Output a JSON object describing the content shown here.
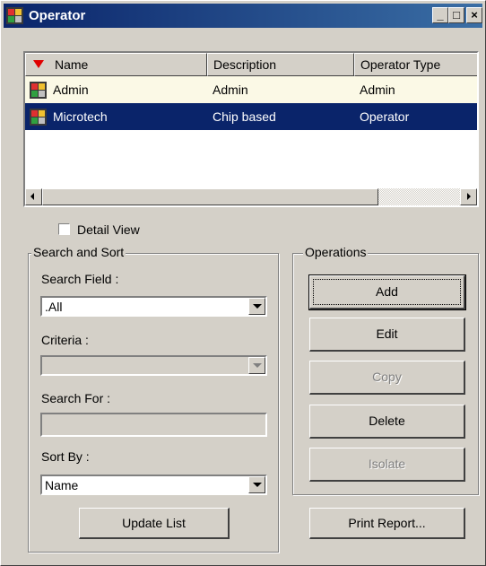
{
  "window": {
    "title": "Operator",
    "controls": {
      "minimize": "_",
      "maximize": "□",
      "close": "×"
    }
  },
  "list": {
    "columns": [
      {
        "label": "Name",
        "sorted": "descending"
      },
      {
        "label": "Description"
      },
      {
        "label": "Operator Type"
      }
    ],
    "rows": [
      {
        "name": "Admin",
        "description": "Admin",
        "type": "Admin",
        "selected": false
      },
      {
        "name": "Microtech",
        "description": "Chip based",
        "type": "Operator",
        "selected": true
      }
    ],
    "colors": {
      "selection": "#0a246a",
      "row_highlight": "#fbf9e6",
      "sort_arrow": "#e00000"
    }
  },
  "detail_view": {
    "label": "Detail View",
    "checked": false
  },
  "search_sort": {
    "legend": "Search and Sort",
    "search_field_label": "Search Field :",
    "search_field_value": ".All",
    "criteria_label": "Criteria :",
    "criteria_value": "",
    "search_for_label": "Search For :",
    "search_for_value": "",
    "sort_by_label": "Sort By :",
    "sort_by_value": "Name",
    "update_button": "Update List"
  },
  "operations": {
    "legend": "Operations",
    "add": "Add",
    "edit": "Edit",
    "copy": "Copy",
    "delete": "Delete",
    "isolate": "Isolate",
    "print_report": "Print Report..."
  }
}
